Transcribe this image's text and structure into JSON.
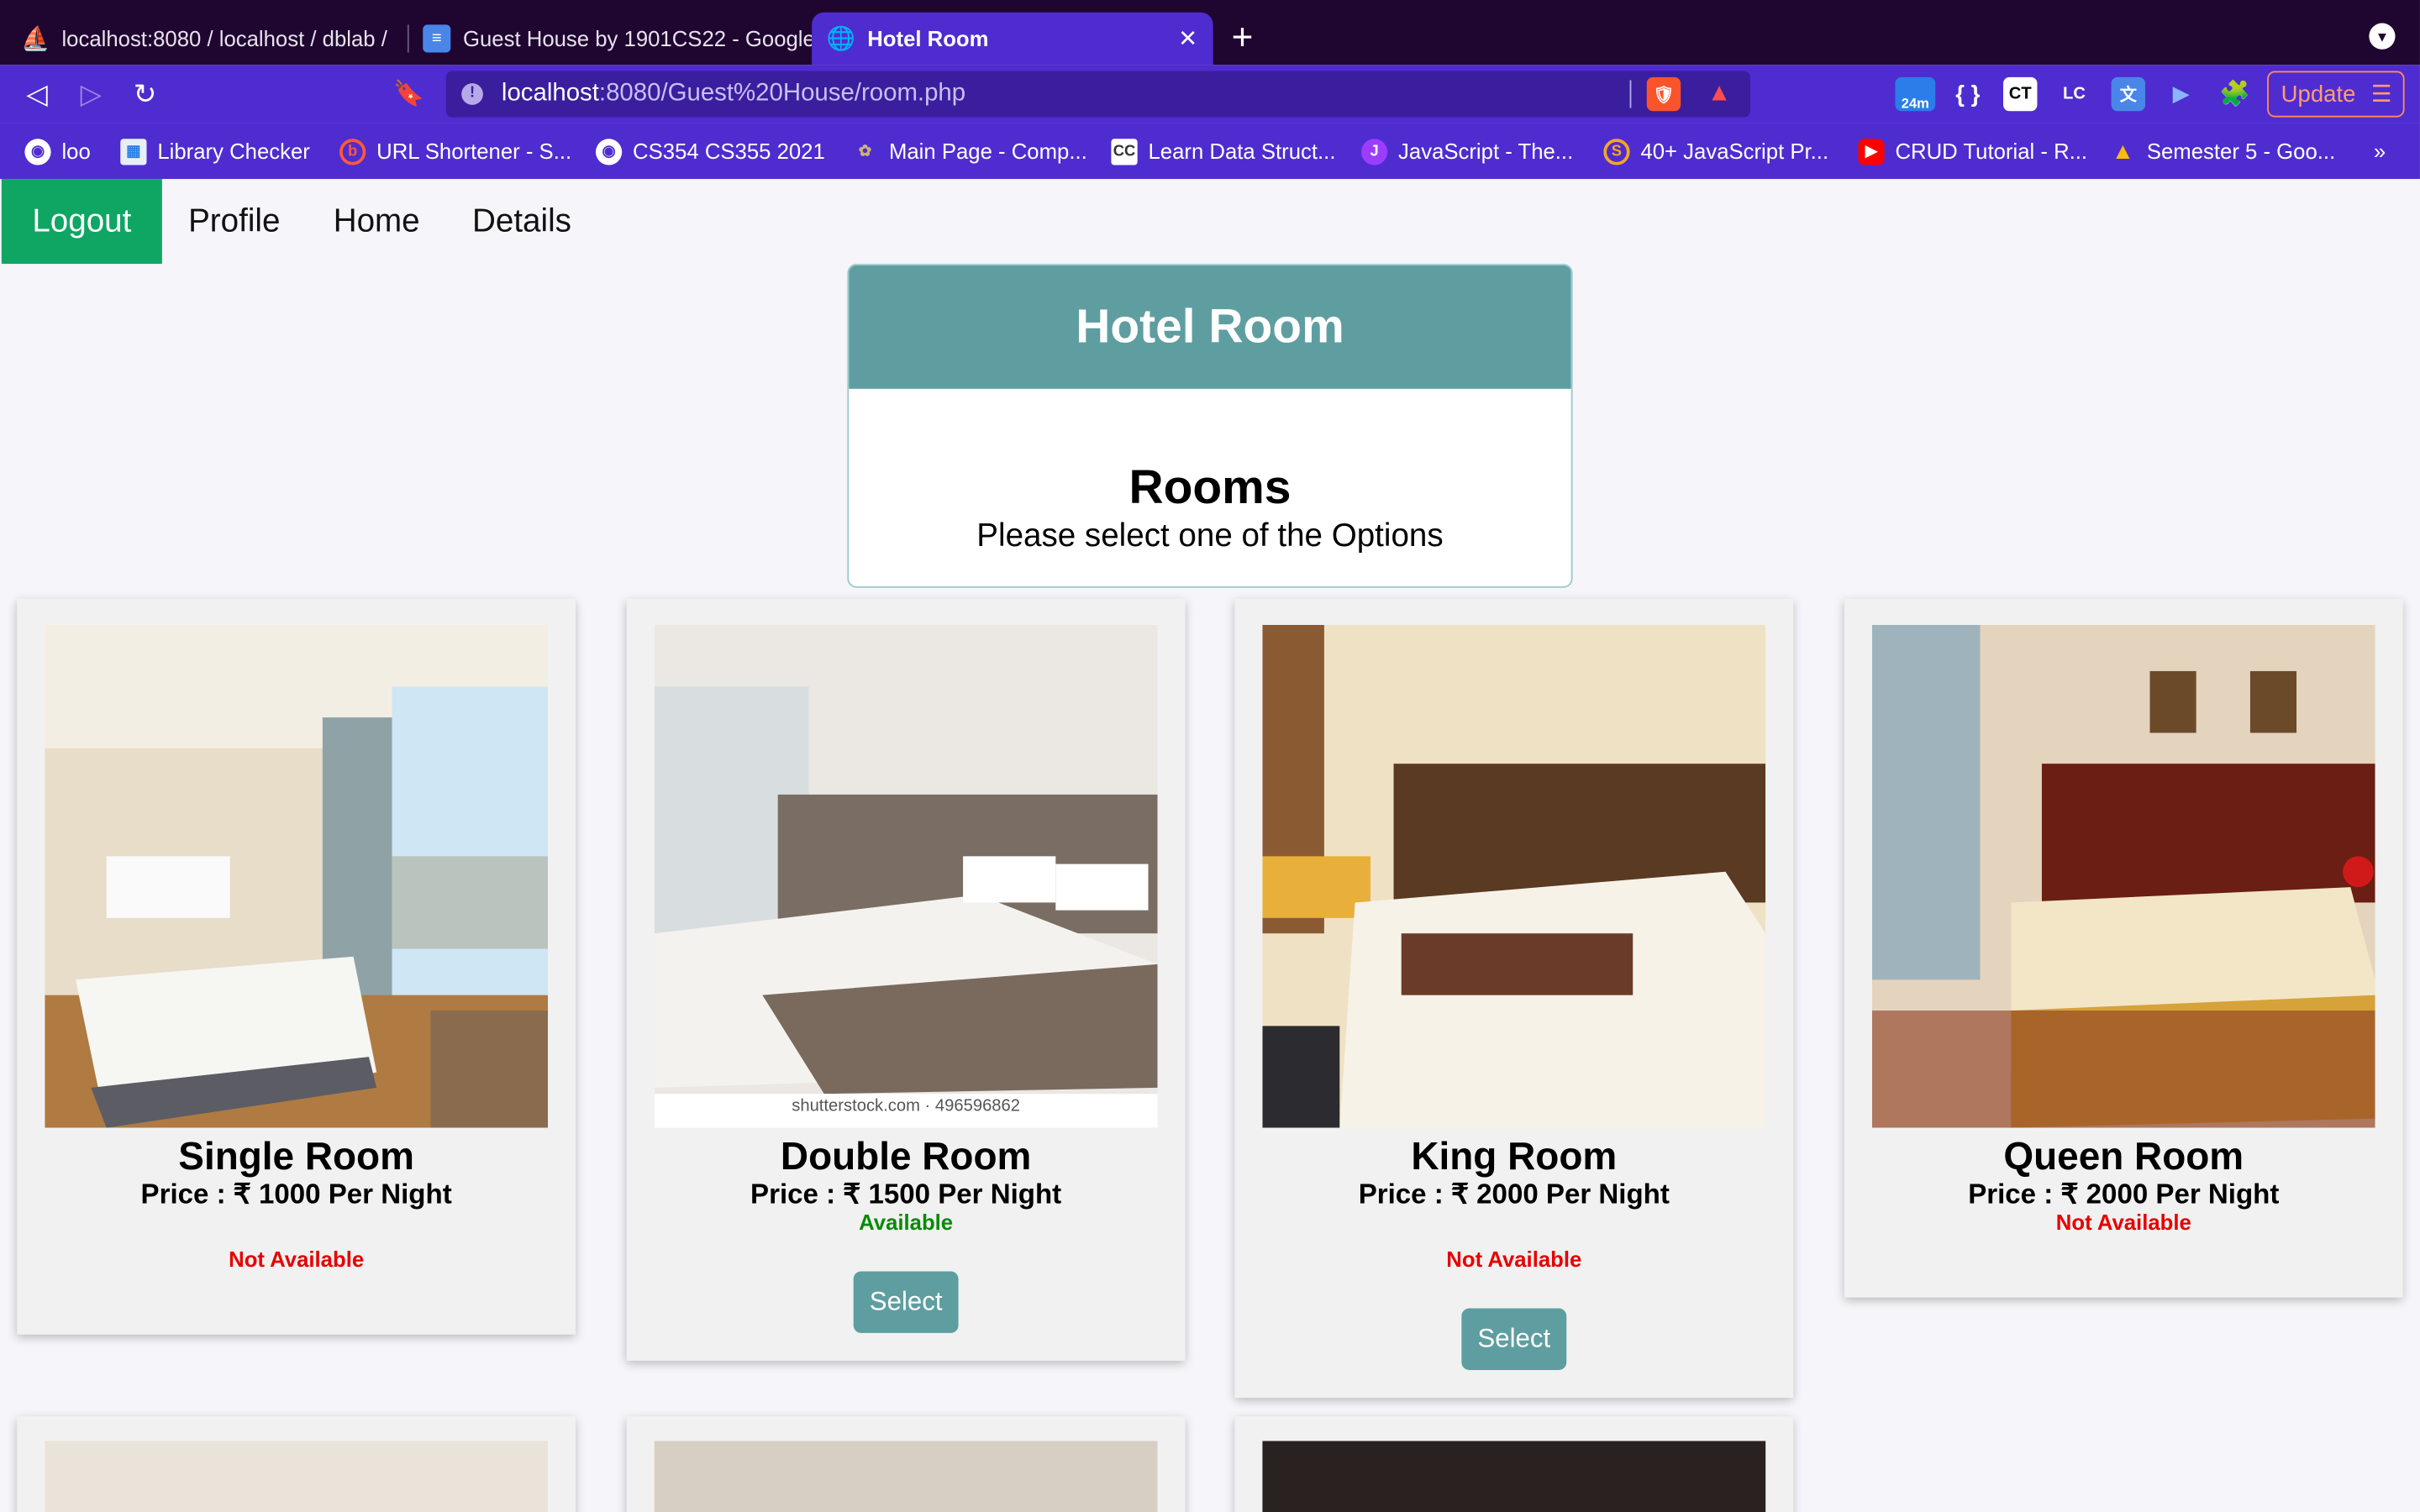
{
  "browser": {
    "tabs": [
      {
        "label": "localhost:8080 / localhost / dblab /",
        "active": false
      },
      {
        "label": "Guest House by 1901CS22 - Google",
        "active": false
      },
      {
        "label": "Hotel Room",
        "active": true
      }
    ],
    "url_host": "localhost",
    "url_rest": ":8080/Guest%20House/room.php",
    "extensions": {
      "badge": "24m",
      "ct": "CT",
      "lc": "LC"
    },
    "update_label": "Update",
    "bookmarks": [
      {
        "label": "loo"
      },
      {
        "label": "Library Checker"
      },
      {
        "label": "URL Shortener - S..."
      },
      {
        "label": "CS354 CS355 2021"
      },
      {
        "label": "Main Page - Comp..."
      },
      {
        "label": "Learn Data Struct..."
      },
      {
        "label": "JavaScript - The..."
      },
      {
        "label": "40+ JavaScript Pr..."
      },
      {
        "label": "CRUD Tutorial - R..."
      },
      {
        "label": "Semester 5 - Goo..."
      }
    ],
    "more_bookmarks": "»"
  },
  "nav": {
    "logout": "Logout",
    "profile": "Profile",
    "home": "Home",
    "details": "Details"
  },
  "header": {
    "title": "Hotel Room",
    "heading": "Rooms",
    "subtitle": "Please select one of the Options"
  },
  "rooms": [
    {
      "name": "Single Room",
      "price": "Price : ₹ 1000 Per Night",
      "status": "Not Available",
      "status_color": "#e60000",
      "button": ""
    },
    {
      "name": "Double Room",
      "price": "Price : ₹ 1500 Per Night",
      "status": "Available",
      "status_color": "#0a8a0a",
      "button": "Select",
      "watermark": "shutterstock.com · 496596862"
    },
    {
      "name": "King Room",
      "price": "Price : ₹ 2000 Per Night",
      "status": "Not Available",
      "status_color": "#e60000",
      "button": "Select"
    },
    {
      "name": "Queen Room",
      "price": "Price : ₹ 2000 Per Night",
      "status": "Not Available",
      "status_color": "#e60000",
      "button": ""
    }
  ],
  "colors": {
    "accent": "#5f9ea0",
    "logout": "#0fa664",
    "browser": "#4f2ccf"
  }
}
